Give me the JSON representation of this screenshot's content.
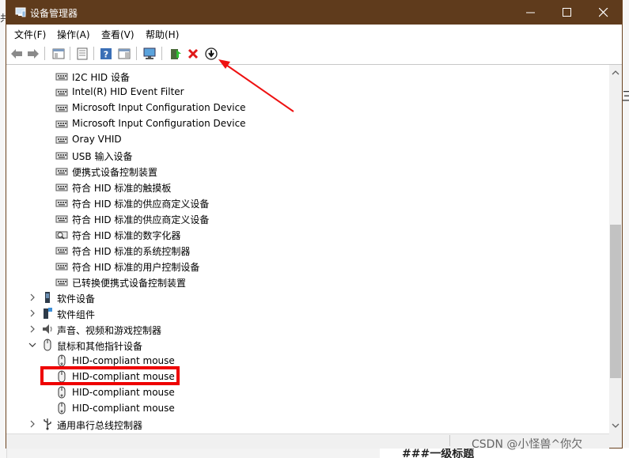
{
  "window": {
    "title": "设备管理器",
    "controls": {
      "minimize": "minimize",
      "maximize": "maximize",
      "close": "close"
    }
  },
  "menubar": {
    "items": [
      {
        "label": "文件(F)"
      },
      {
        "label": "操作(A)"
      },
      {
        "label": "查看(V)"
      },
      {
        "label": "帮助(H)"
      }
    ]
  },
  "toolbar": {
    "buttons": [
      "back-icon",
      "forward-icon",
      "show-hide-console-tree-icon",
      "properties-icon",
      "help-icon",
      "action-pane-icon",
      "scan-hardware-icon",
      "update-driver-icon",
      "uninstall-device-icon",
      "disable-device-icon"
    ]
  },
  "tree": {
    "hid_children": [
      "I2C HID 设备",
      "Intel(R) HID Event Filter",
      "Microsoft Input Configuration Device",
      "Microsoft Input Configuration Device",
      "Oray VHID",
      "USB 输入设备",
      "便携式设备控制装置",
      "符合 HID 标准的触摸板",
      "符合 HID 标准的供应商定义设备",
      "符合 HID 标准的供应商定义设备",
      "符合 HID 标准的数字化器",
      "符合 HID 标准的系统控制器",
      "符合 HID 标准的用户控制设备",
      "已转换便携式设备控制装置"
    ],
    "categories": [
      {
        "label": "软件设备",
        "expanded": false
      },
      {
        "label": "软件组件",
        "expanded": false
      },
      {
        "label": "声音、视频和游戏控制器",
        "expanded": false
      },
      {
        "label": "鼠标和其他指针设备",
        "expanded": true
      }
    ],
    "mouse_children": [
      "HID-compliant mouse",
      "HID-compliant mouse",
      "HID-compliant mouse",
      "HID-compliant mouse"
    ],
    "last_category": {
      "label": "通用串行总线控制器",
      "expanded": false
    }
  },
  "annotation": {
    "highlight_color": "#ee0000",
    "arrow_color": "#ee1111"
  },
  "watermark": "CSDN @小怪兽^你欠",
  "background_app": {
    "bottom_heading": "###一级标题"
  },
  "colors": {
    "titlebar": "#5f3b1c",
    "selection_box": "#ee0000"
  }
}
